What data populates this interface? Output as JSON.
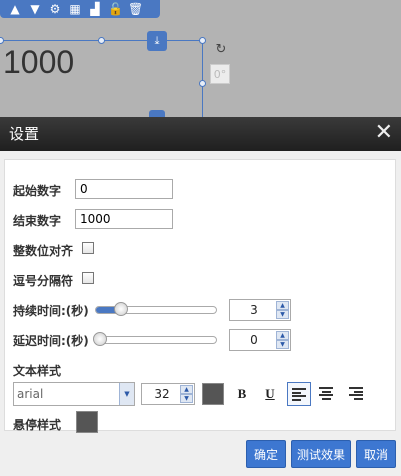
{
  "canvas": {
    "number_display": "1000",
    "degree_label": "0°",
    "toolbar_icons": [
      "chevron-up-icon",
      "chevron-down-icon",
      "gear-icon",
      "table-icon",
      "bar-chart-icon",
      "lock-icon",
      "trash-icon"
    ]
  },
  "dialog": {
    "title": "设置",
    "close_label": "✕",
    "fields": {
      "start_label": "起始数字",
      "start_value": "0",
      "end_label": "结束数字",
      "end_value": "1000",
      "align_label": "整数位对齐",
      "comma_label": "逗号分隔符",
      "duration_label": "持续时间:(秒)",
      "duration_value": "3",
      "delay_label": "延迟时间:(秒)",
      "delay_value": "0",
      "text_style_label": "文本样式",
      "font_value": "arial",
      "font_size_value": "32",
      "bold_label": "B",
      "underline_label": "U",
      "hover_style_label": "悬停样式"
    },
    "buttons": {
      "confirm": "确定",
      "test": "测试效果",
      "cancel": "取消"
    }
  },
  "colors": {
    "accent": "#3d77d1",
    "text_color_swatch": "#555555",
    "hover_color_swatch": "#555555"
  }
}
